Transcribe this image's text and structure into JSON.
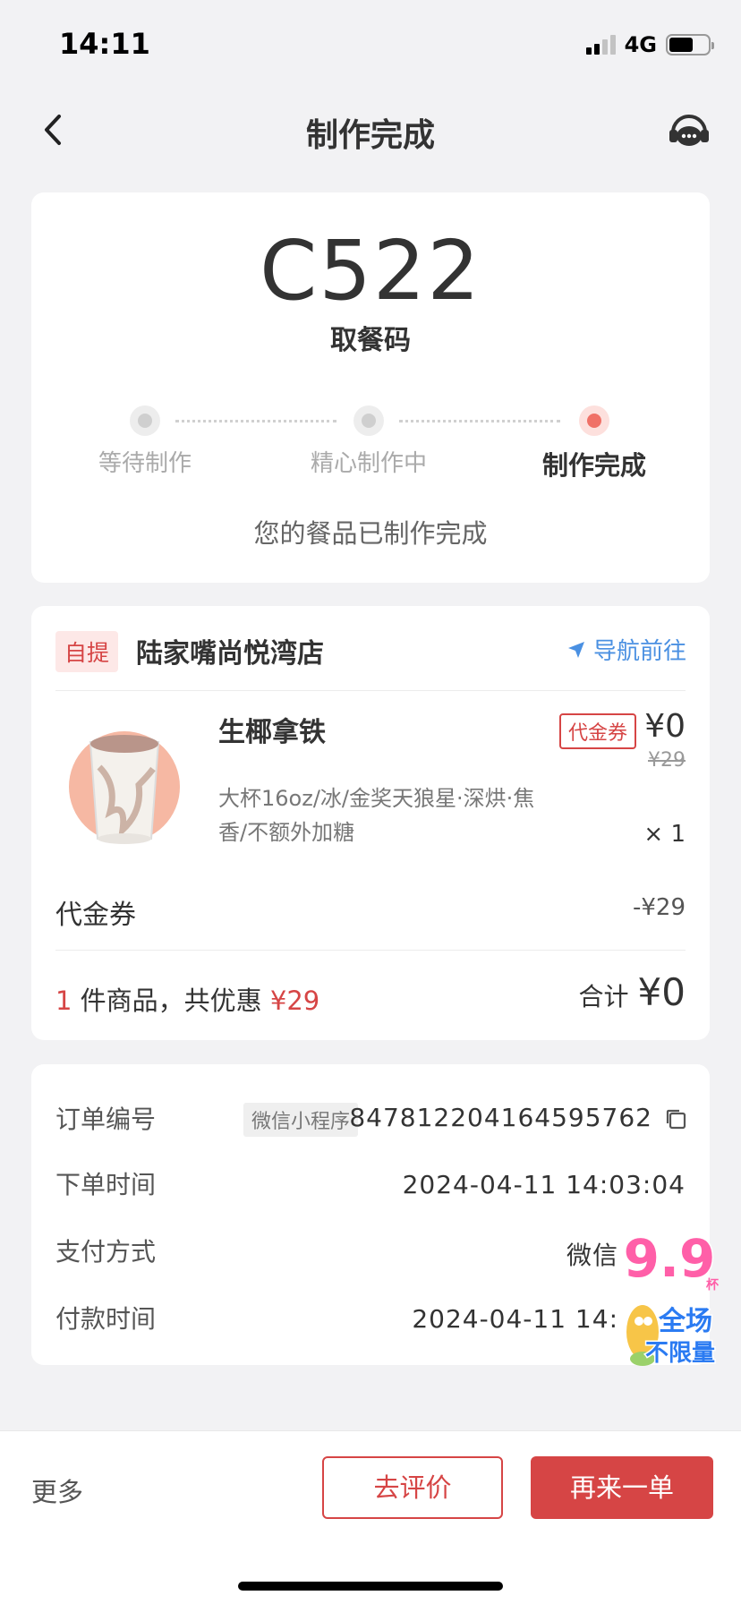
{
  "status_bar": {
    "time": "14:11",
    "network": "4G",
    "battery_level": 0.62
  },
  "nav": {
    "title": "制作完成"
  },
  "pickup": {
    "code": "C522",
    "code_label": "取餐码",
    "steps": [
      {
        "label": "等待制作",
        "active": false
      },
      {
        "label": "精心制作中",
        "active": false
      },
      {
        "label": "制作完成",
        "active": true
      }
    ],
    "message": "您的餐品已制作完成"
  },
  "store": {
    "badge": "自提",
    "name": "陆家嘴尚悦湾店",
    "navigate": "导航前往"
  },
  "product": {
    "name": "生椰拿铁",
    "tag": "代金券",
    "price": "¥0",
    "original_price": "¥29",
    "spec": "大杯16oz/冰/金奖天狼星·深烘·焦香/不额外加糖",
    "qty": "× 1"
  },
  "voucher": {
    "label": "代金券",
    "value": "-¥29"
  },
  "summary": {
    "count": "1",
    "count_suffix": "件商品，共优惠",
    "discount": "¥29",
    "total_label": "合计",
    "total": "¥0"
  },
  "order_info": {
    "order_no_label": "订单编号",
    "channel": "微信小程序",
    "order_no": "847812204164595762",
    "order_time_label": "下单时间",
    "order_time": "2024-04-11 14:03:04",
    "payment_label": "支付方式",
    "payment": "微信",
    "pay_time_label": "付款时间",
    "pay_time": "2024-04-11 14:"
  },
  "promo": {
    "number": "9.9",
    "unit": "杯",
    "line1": "全场",
    "line2": "不限量"
  },
  "bottom": {
    "more": "更多",
    "review": "去评价",
    "reorder": "再来一单"
  },
  "colors": {
    "accent": "#d64545",
    "link": "#4a90e2",
    "active_dot": "#f07167"
  }
}
